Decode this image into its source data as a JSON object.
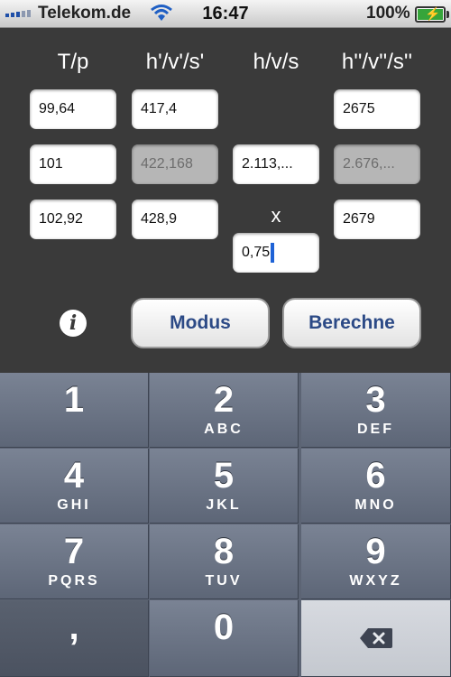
{
  "status": {
    "carrier": "Telekom.de",
    "time": "16:47",
    "battery": "100%"
  },
  "headers": [
    "T/p",
    "h'/v'/s'",
    "h/v/s",
    "h''/v''/s''"
  ],
  "fields": {
    "r1c1": "99,64",
    "r1c2": "417,4",
    "r1c4": "2675",
    "r2c1": "101",
    "r2c2": "422,168",
    "r2c3": "2.113,...",
    "r2c4": "2.676,...",
    "r3c1": "102,92",
    "r3c2": "428,9",
    "r3c4": "2679",
    "x_label": "x",
    "x_value": "0,75"
  },
  "buttons": {
    "info": "i",
    "mode": "Modus",
    "calculate": "Berechne"
  },
  "keypad": {
    "k1": {
      "digit": "1",
      "letters": ""
    },
    "k2": {
      "digit": "2",
      "letters": "ABC"
    },
    "k3": {
      "digit": "3",
      "letters": "DEF"
    },
    "k4": {
      "digit": "4",
      "letters": "GHI"
    },
    "k5": {
      "digit": "5",
      "letters": "JKL"
    },
    "k6": {
      "digit": "6",
      "letters": "MNO"
    },
    "k7": {
      "digit": "7",
      "letters": "PQRS"
    },
    "k8": {
      "digit": "8",
      "letters": "TUV"
    },
    "k9": {
      "digit": "9",
      "letters": "WXYZ"
    },
    "comma": ",",
    "k0": {
      "digit": "0"
    }
  },
  "colors": {
    "button_text": "#2c4a86",
    "cursor": "#1e62d6",
    "battery": "#36a53a"
  }
}
